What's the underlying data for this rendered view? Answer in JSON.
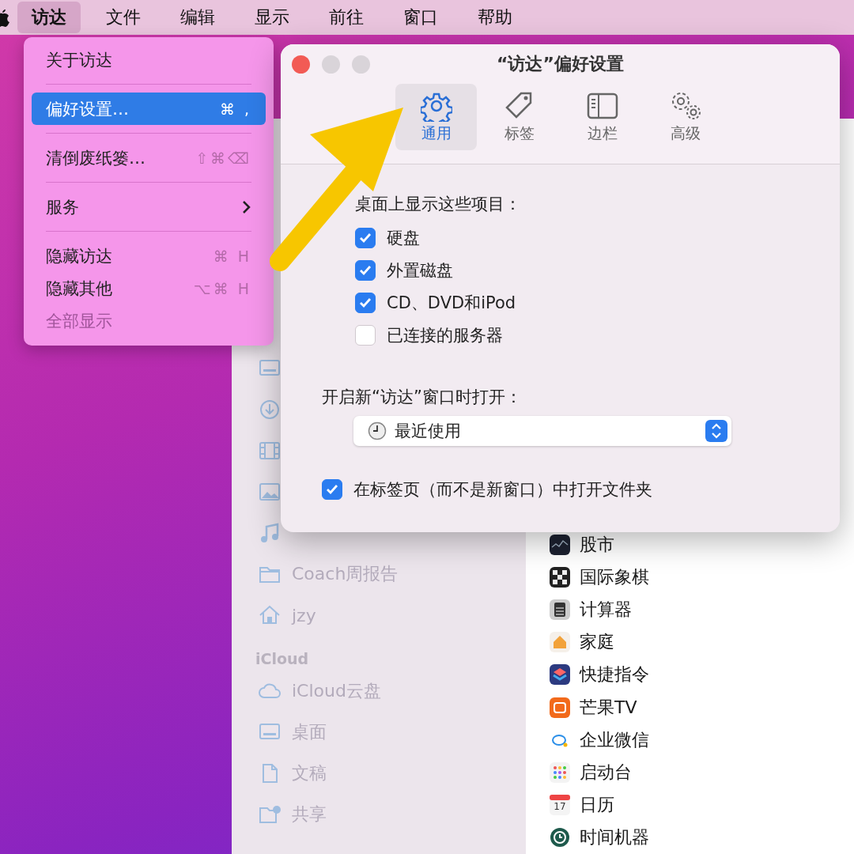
{
  "menu_bar": {
    "items": [
      {
        "label": "访达",
        "selected": true
      },
      {
        "label": "文件",
        "selected": false
      },
      {
        "label": "编辑",
        "selected": false
      },
      {
        "label": "显示",
        "selected": false
      },
      {
        "label": "前往",
        "selected": false
      },
      {
        "label": "窗口",
        "selected": false
      },
      {
        "label": "帮助",
        "selected": false
      }
    ]
  },
  "menu": {
    "items": [
      {
        "kind": "item",
        "label": "关于访达",
        "selected": false,
        "disabled": false
      },
      {
        "kind": "separator"
      },
      {
        "kind": "item",
        "label": "偏好设置…",
        "shortcut": "⌘ ,",
        "selected": true,
        "disabled": false
      },
      {
        "kind": "separator"
      },
      {
        "kind": "item",
        "label": "清倒废纸篓…",
        "shortcut": "⇧⌘⌫",
        "selected": false,
        "disabled": false
      },
      {
        "kind": "separator"
      },
      {
        "kind": "submenu",
        "label": "服务",
        "selected": false,
        "disabled": false
      },
      {
        "kind": "separator"
      },
      {
        "kind": "item",
        "label": "隐藏访达",
        "shortcut": "⌘ H",
        "selected": false,
        "disabled": false
      },
      {
        "kind": "item",
        "label": "隐藏其他",
        "shortcut": "⌥⌘ H",
        "selected": false,
        "disabled": false
      },
      {
        "kind": "item",
        "label": "全部显示",
        "selected": false,
        "disabled": true
      }
    ]
  },
  "finder": {
    "sidebar": {
      "items": [
        {
          "kind": "item"
        },
        {
          "kind": "item"
        },
        {
          "kind": "item"
        },
        {
          "kind": "item"
        },
        {
          "kind": "item"
        },
        {
          "kind": "item",
          "label": "Coach周报告"
        },
        {
          "kind": "item",
          "label": "jzy"
        },
        {
          "kind": "heading",
          "label": "iCloud"
        },
        {
          "kind": "item",
          "label": "iCloud云盘"
        },
        {
          "kind": "item",
          "label": "桌面"
        },
        {
          "kind": "item",
          "label": "文稿"
        },
        {
          "kind": "item",
          "label": "共享"
        }
      ]
    },
    "apps": [
      {
        "label": "股市"
      },
      {
        "label": "国际象棋"
      },
      {
        "label": "计算器"
      },
      {
        "label": "家庭"
      },
      {
        "label": "快捷指令"
      },
      {
        "label": "芒果TV"
      },
      {
        "label": "企业微信"
      },
      {
        "label": "启动台"
      },
      {
        "label": "日历",
        "badge": "17"
      },
      {
        "label": "时间机器"
      }
    ]
  },
  "dialog": {
    "title": "“访达”偏好设置",
    "tabs": [
      {
        "label": "通用",
        "selected": true
      },
      {
        "label": "标签",
        "selected": false
      },
      {
        "label": "边栏",
        "selected": false
      },
      {
        "label": "高级",
        "selected": false
      }
    ],
    "desktop_section": {
      "label": "桌面上显示这些项目：",
      "options": [
        {
          "label": "硬盘",
          "checked": true
        },
        {
          "label": "外置磁盘",
          "checked": true
        },
        {
          "label": "CD、DVD和iPod",
          "checked": true
        },
        {
          "label": "已连接的服务器",
          "checked": false
        }
      ]
    },
    "new_window": {
      "label": "开启新“访达”窗口时打开：",
      "value": "最近使用"
    },
    "tabs_option": {
      "label": "在标签页（而不是新窗口）中打开文件夹",
      "checked": true
    }
  }
}
